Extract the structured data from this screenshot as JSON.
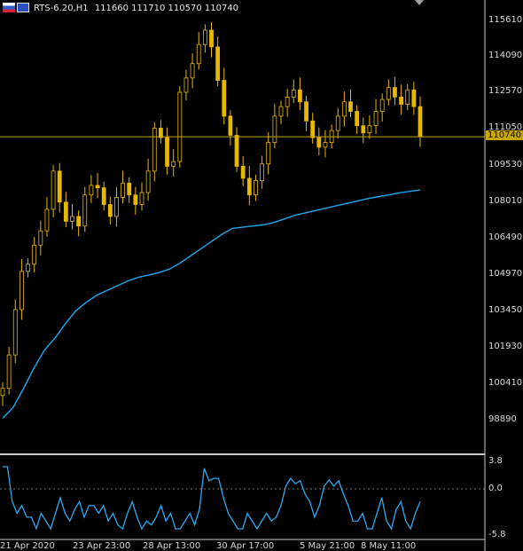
{
  "window": {
    "symbol": "RTS-6.20,H1",
    "ohlc": "111660 111710 110570 110740"
  },
  "price_axis": {
    "labels": [
      "115610",
      "114090",
      "112570",
      "111050",
      "109530",
      "108010",
      "106490",
      "104970",
      "103450",
      "101930",
      "100410",
      "98890"
    ],
    "current_price_tag": "110740"
  },
  "indicator_axis": {
    "labels": [
      "3.8",
      "0.0",
      "-5.8"
    ]
  },
  "time_axis": {
    "labels": [
      "21 Apr 2020",
      "23 Apr 23:00",
      "28 Apr 13:00",
      "30 Apr 17:00",
      "5 May 21:00",
      "8 May 11:00"
    ]
  },
  "colors": {
    "background": "#000000",
    "candle": "#e6b800",
    "moving_average": "#1ea7f0",
    "oscillator": "#2aa8f0",
    "price_line": "#c8a800",
    "grid_text": "#d8d8d8",
    "separator": "#c8c8c8"
  },
  "chart_data": {
    "type": "line",
    "price_series": {
      "name": "",
      "y_range": [
        98890,
        115610
      ],
      "close_values": [
        100200,
        101600,
        103500,
        105100,
        105400,
        106200,
        106800,
        107700,
        109300,
        108000,
        107200,
        107400,
        107000,
        108300,
        108700,
        108600,
        107900,
        107400,
        108200,
        108800,
        108300,
        107900,
        108400,
        109300,
        111100,
        110700,
        109500,
        109700,
        112600,
        113200,
        113800,
        114600,
        115200,
        114500,
        113100,
        111600,
        110800,
        109500,
        109000,
        108300,
        108900,
        109600,
        110500,
        111600,
        112000,
        112400,
        112700,
        112200,
        111400,
        110700,
        110300,
        110500,
        111000,
        111600,
        112200,
        111800,
        111200,
        110900,
        111200,
        111800,
        112300,
        112800,
        112400,
        112100,
        112700,
        112000,
        110740
      ],
      "ma_values": [
        98950,
        99400,
        100200,
        101050,
        101800,
        102300,
        102900,
        103450,
        103800,
        104100,
        104300,
        104500,
        104700,
        104850,
        104950,
        105050,
        105200,
        105450,
        105750,
        106050,
        106350,
        106650,
        106900,
        106950,
        107000,
        107050,
        107150,
        107300,
        107450,
        107550,
        107650,
        107750,
        107850,
        107950,
        108050,
        108150,
        108230,
        108300,
        108390,
        108450,
        108510
      ]
    },
    "oscillator_series": {
      "name": "",
      "y_range": [
        -5.8,
        3.8
      ],
      "values": [
        3.0,
        3.0,
        -1.5,
        -3.0,
        -2.0,
        -3.5,
        -3.5,
        -5.0,
        -3.0,
        -4.0,
        -5.0,
        -3.0,
        -1.0,
        -3.0,
        -4.0,
        -2.5,
        -1.5,
        -3.5,
        -2.0,
        -2.0,
        -3.0,
        -2.0,
        -4.0,
        -3.0,
        -4.5,
        -5.0,
        -3.0,
        -1.5,
        -3.5,
        -5.0,
        -4.0,
        -4.5,
        -3.5,
        -2.0,
        -4.0,
        -3.0,
        -5.0,
        -5.0,
        -4.0,
        -3.0,
        -4.5,
        -2.5,
        2.8,
        1.2,
        1.5,
        1.5,
        -1.0,
        -3.0,
        -4.0,
        -5.0,
        -5.0,
        -3.0,
        -4.0,
        -5.0,
        -4.0,
        -3.0,
        -4.0,
        -3.5,
        -2.0,
        0.5,
        1.5,
        0.8,
        1.2,
        -0.5,
        -1.5,
        -3.5,
        -2.0,
        0.5,
        1.3,
        0.5,
        1.2,
        -0.5,
        -2.0,
        -4.0,
        -4.0,
        -3.0,
        -5.0,
        -5.0,
        -3.0,
        -1.0,
        -4.0,
        -5.0,
        -2.5,
        -1.5,
        -4.0,
        -5.0,
        -3.0,
        -1.5
      ]
    },
    "ylabel": "",
    "xlabel": "",
    "title": ""
  }
}
